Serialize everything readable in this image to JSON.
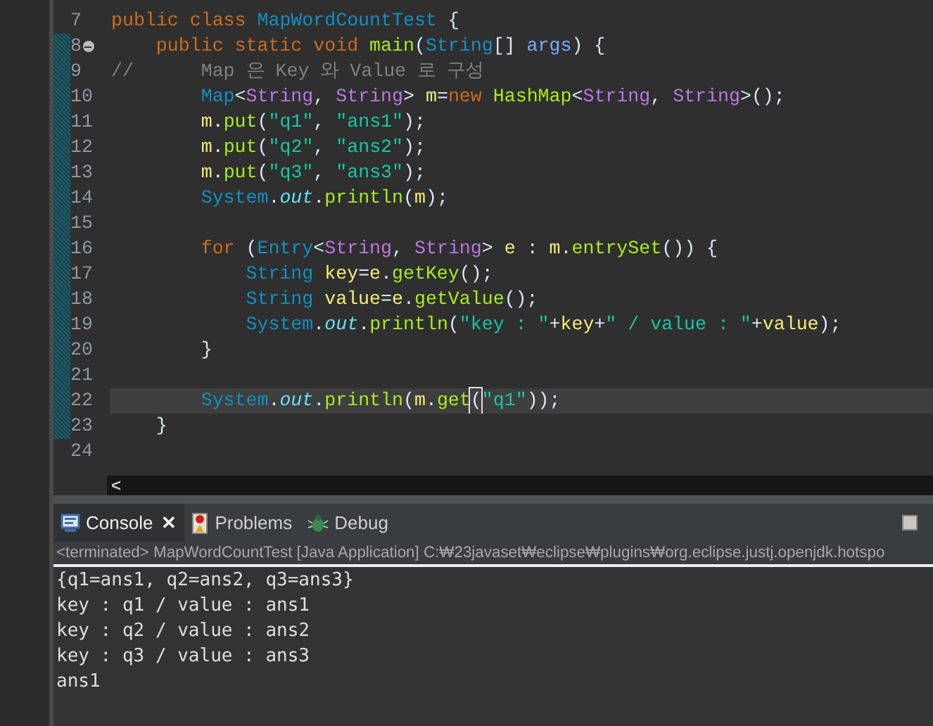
{
  "editor": {
    "lines": [
      {
        "number": "7",
        "folded_marker": false,
        "changed": false,
        "current": false,
        "tokens": [
          {
            "kind": "keyword",
            "text": "public class "
          },
          {
            "kind": "type",
            "text": "MapWordCountTest"
          },
          {
            "kind": "plain",
            "text": " {"
          }
        ]
      },
      {
        "number": "8",
        "folded_marker": true,
        "changed": true,
        "current": false,
        "tokens": [
          {
            "kind": "keyword",
            "text": "    public static void "
          },
          {
            "kind": "method",
            "text": "main"
          },
          {
            "kind": "plain",
            "text": "("
          },
          {
            "kind": "type",
            "text": "String"
          },
          {
            "kind": "plain",
            "text": "[] "
          },
          {
            "kind": "param",
            "text": "args"
          },
          {
            "kind": "plain",
            "text": ") {"
          }
        ]
      },
      {
        "number": "9",
        "folded_marker": false,
        "changed": true,
        "current": false,
        "tokens": [
          {
            "kind": "comment",
            "text": "//      Map 은 Key 와 Value 로 구성"
          }
        ]
      },
      {
        "number": "10",
        "folded_marker": false,
        "changed": true,
        "current": false,
        "tokens": [
          {
            "kind": "type",
            "text": "        Map"
          },
          {
            "kind": "plain",
            "text": "<"
          },
          {
            "kind": "typeparam",
            "text": "String"
          },
          {
            "kind": "plain",
            "text": ", "
          },
          {
            "kind": "typeparam",
            "text": "String"
          },
          {
            "kind": "plain",
            "text": "> "
          },
          {
            "kind": "local",
            "text": "m"
          },
          {
            "kind": "plain",
            "text": "="
          },
          {
            "kind": "keyword",
            "text": "new "
          },
          {
            "kind": "method",
            "text": "HashMap"
          },
          {
            "kind": "plain",
            "text": "<"
          },
          {
            "kind": "typeparam",
            "text": "String"
          },
          {
            "kind": "plain",
            "text": ", "
          },
          {
            "kind": "typeparam",
            "text": "String"
          },
          {
            "kind": "plain",
            "text": ">();"
          }
        ]
      },
      {
        "number": "11",
        "folded_marker": false,
        "changed": true,
        "current": false,
        "tokens": [
          {
            "kind": "local",
            "text": "        m"
          },
          {
            "kind": "plain",
            "text": "."
          },
          {
            "kind": "call",
            "text": "put"
          },
          {
            "kind": "plain",
            "text": "("
          },
          {
            "kind": "string",
            "text": "\"q1\""
          },
          {
            "kind": "plain",
            "text": ", "
          },
          {
            "kind": "string",
            "text": "\"ans1\""
          },
          {
            "kind": "plain",
            "text": ");"
          }
        ]
      },
      {
        "number": "12",
        "folded_marker": false,
        "changed": true,
        "current": false,
        "tokens": [
          {
            "kind": "local",
            "text": "        m"
          },
          {
            "kind": "plain",
            "text": "."
          },
          {
            "kind": "call",
            "text": "put"
          },
          {
            "kind": "plain",
            "text": "("
          },
          {
            "kind": "string",
            "text": "\"q2\""
          },
          {
            "kind": "plain",
            "text": ", "
          },
          {
            "kind": "string",
            "text": "\"ans2\""
          },
          {
            "kind": "plain",
            "text": ");"
          }
        ]
      },
      {
        "number": "13",
        "folded_marker": false,
        "changed": true,
        "current": false,
        "tokens": [
          {
            "kind": "local",
            "text": "        m"
          },
          {
            "kind": "plain",
            "text": "."
          },
          {
            "kind": "call",
            "text": "put"
          },
          {
            "kind": "plain",
            "text": "("
          },
          {
            "kind": "string",
            "text": "\"q3\""
          },
          {
            "kind": "plain",
            "text": ", "
          },
          {
            "kind": "string",
            "text": "\"ans3\""
          },
          {
            "kind": "plain",
            "text": ");"
          }
        ]
      },
      {
        "number": "14",
        "folded_marker": false,
        "changed": true,
        "current": false,
        "tokens": [
          {
            "kind": "type",
            "text": "        System"
          },
          {
            "kind": "plain",
            "text": "."
          },
          {
            "kind": "field",
            "text": "out"
          },
          {
            "kind": "plain",
            "text": "."
          },
          {
            "kind": "call",
            "text": "println"
          },
          {
            "kind": "plain",
            "text": "("
          },
          {
            "kind": "local",
            "text": "m"
          },
          {
            "kind": "plain",
            "text": ");"
          }
        ]
      },
      {
        "number": "15",
        "folded_marker": false,
        "changed": true,
        "current": false
      },
      {
        "number": "16",
        "folded_marker": false,
        "changed": true,
        "current": false,
        "tokens": [
          {
            "kind": "keyword",
            "text": "        for "
          },
          {
            "kind": "plain",
            "text": "("
          },
          {
            "kind": "type",
            "text": "Entry"
          },
          {
            "kind": "plain",
            "text": "<"
          },
          {
            "kind": "typeparam",
            "text": "String"
          },
          {
            "kind": "plain",
            "text": ", "
          },
          {
            "kind": "typeparam",
            "text": "String"
          },
          {
            "kind": "plain",
            "text": "> "
          },
          {
            "kind": "local",
            "text": "e"
          },
          {
            "kind": "plain",
            "text": " : "
          },
          {
            "kind": "local",
            "text": "m"
          },
          {
            "kind": "plain",
            "text": "."
          },
          {
            "kind": "call",
            "text": "entrySet"
          },
          {
            "kind": "plain",
            "text": "()) {"
          }
        ]
      },
      {
        "number": "17",
        "folded_marker": false,
        "changed": true,
        "current": false,
        "tokens": [
          {
            "kind": "type",
            "text": "            String "
          },
          {
            "kind": "local",
            "text": "key"
          },
          {
            "kind": "plain",
            "text": "="
          },
          {
            "kind": "local",
            "text": "e"
          },
          {
            "kind": "plain",
            "text": "."
          },
          {
            "kind": "call",
            "text": "getKey"
          },
          {
            "kind": "plain",
            "text": "();"
          }
        ]
      },
      {
        "number": "18",
        "folded_marker": false,
        "changed": true,
        "current": false,
        "tokens": [
          {
            "kind": "type",
            "text": "            String "
          },
          {
            "kind": "local",
            "text": "value"
          },
          {
            "kind": "plain",
            "text": "="
          },
          {
            "kind": "local",
            "text": "e"
          },
          {
            "kind": "plain",
            "text": "."
          },
          {
            "kind": "call",
            "text": "getValue"
          },
          {
            "kind": "plain",
            "text": "();"
          }
        ]
      },
      {
        "number": "19",
        "folded_marker": false,
        "changed": true,
        "current": false,
        "tokens": [
          {
            "kind": "type",
            "text": "            System"
          },
          {
            "kind": "plain",
            "text": "."
          },
          {
            "kind": "field",
            "text": "out"
          },
          {
            "kind": "plain",
            "text": "."
          },
          {
            "kind": "call",
            "text": "println"
          },
          {
            "kind": "plain",
            "text": "("
          },
          {
            "kind": "string",
            "text": "\"key : \""
          },
          {
            "kind": "plain",
            "text": "+"
          },
          {
            "kind": "local",
            "text": "key"
          },
          {
            "kind": "plain",
            "text": "+"
          },
          {
            "kind": "string",
            "text": "\" / value : \""
          },
          {
            "kind": "plain",
            "text": "+"
          },
          {
            "kind": "local",
            "text": "value"
          },
          {
            "kind": "plain",
            "text": ");"
          }
        ]
      },
      {
        "number": "20",
        "folded_marker": false,
        "changed": true,
        "current": false,
        "tokens": [
          {
            "kind": "plain",
            "text": "        }"
          }
        ]
      },
      {
        "number": "21",
        "folded_marker": false,
        "changed": true,
        "current": false
      },
      {
        "number": "22",
        "folded_marker": false,
        "changed": true,
        "current": true,
        "tokens": [
          {
            "kind": "type",
            "text": "        System"
          },
          {
            "kind": "plain",
            "text": "."
          },
          {
            "kind": "field",
            "text": "out"
          },
          {
            "kind": "plain",
            "text": "."
          },
          {
            "kind": "call",
            "text": "println"
          },
          {
            "kind": "plain",
            "text": "("
          },
          {
            "kind": "local",
            "text": "m"
          },
          {
            "kind": "plain",
            "text": "."
          },
          {
            "kind": "call",
            "text": "get"
          },
          {
            "kind": "matched",
            "text": "("
          },
          {
            "kind": "string",
            "text": "\"q1\""
          },
          {
            "kind": "plain",
            "text": "));"
          }
        ]
      },
      {
        "number": "23",
        "folded_marker": false,
        "changed": true,
        "current": false,
        "tokens": [
          {
            "kind": "plain",
            "text": "    }"
          }
        ]
      },
      {
        "number": "24",
        "folded_marker": false,
        "changed": false,
        "current": false
      }
    ],
    "scroll_left": "<"
  },
  "console": {
    "tabs": [
      {
        "label": "Console",
        "selected": true,
        "kind": "console"
      },
      {
        "label": "Problems",
        "selected": false,
        "kind": "problems"
      },
      {
        "label": "Debug",
        "selected": false,
        "kind": "debug"
      }
    ],
    "close": "✕",
    "header": "<terminated> MapWordCountTest [Java Application] C:₩23javaset₩eclipse₩plugins₩org.eclipse.justj.openjdk.hotspo",
    "output": [
      "{q1=ans1, q2=ans2, q3=ans3}",
      "key : q1 / value : ans1",
      "key : q2 / value : ans2",
      "key : q3 / value : ans3",
      "ans1"
    ]
  }
}
